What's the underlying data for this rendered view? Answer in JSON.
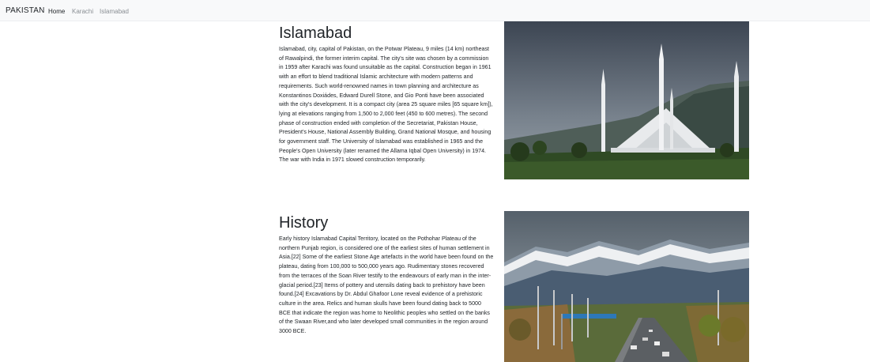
{
  "navbar": {
    "brand": "PAKISTAN",
    "links": [
      {
        "label": "Home",
        "active": true
      },
      {
        "label": "Karachi",
        "active": false
      },
      {
        "label": "Islamabad",
        "active": false
      }
    ]
  },
  "sections": [
    {
      "title": "Islamabad",
      "text": "Islamabad, city, capital of Pakistan, on the Potwar Plateau, 9 miles (14 km) northeast of Rawalpindi, the former interim capital. The city's site was chosen by a commission in 1959 after Karachi was found unsuitable as the capital. Construction began in 1961 with an effort to blend traditional Islamic architecture with modern patterns and requirements. Such world-renowned names in town planning and architecture as Konstantinos Doxiádes, Edward Durell Stone, and Gio Ponti have been associated with the city's development. It is a compact city (area 25 square miles [65 square km]), lying at elevations ranging from 1,500 to 2,000 feet (450 to 600 metres). The second phase of construction ended with completion of the Secretariat, Pakistan House, President's House, National Assembly Building, Grand National Mosque, and housing for government staff. The University of Islamabad was established in 1965 and the People's Open University (later renamed the Allama Iqbal Open University) in 1974. The war with India in 1971 slowed construction temporarily.",
      "image": "faisal-mosque-photo"
    },
    {
      "title": "History",
      "text": "Early history Islamabad Capital Territory, located on the Pothohar Plateau of the northern Punjab region, is considered one of the earliest sites of human settlement in Asia.[22] Some of the earliest Stone Age artefacts in the world have been found on the plateau, dating from 100,000 to 500,000 years ago. Rudimentary stones recovered from the terraces of the Soan River testify to the endeavours of early man in the inter-glacial period.[23] Items of pottery and utensils dating back to prehistory have been found.[24] Excavations by Dr. Abdul Ghafoor Lone reveal evidence of a prehistoric culture in the area. Relics and human skulls have been found dating back to 5000 BCE that indicate the region was home to Neolithic peoples who settled on the banks of the Swaan River,and who later developed small communities in the region around 3000 BCE.",
      "image": "highway-mountains-photo"
    }
  ]
}
